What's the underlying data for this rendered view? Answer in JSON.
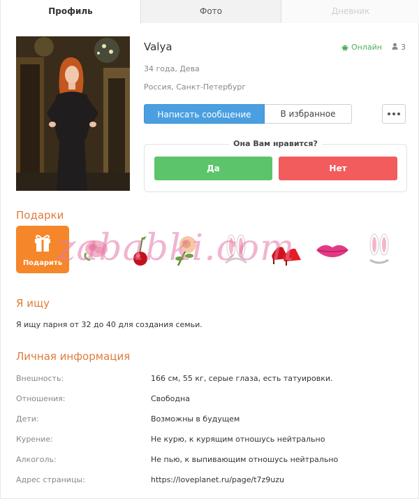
{
  "tabs": [
    {
      "label": "Профиль"
    },
    {
      "label": "Фото"
    },
    {
      "label": "Дневник"
    }
  ],
  "profile": {
    "name": "Valya",
    "online_label": "Онлайн",
    "viewers_count": "3",
    "age_sign": "34 года, Дева",
    "location": "Россия, Санкт-Петербург"
  },
  "actions": {
    "message_label": "Написать сообщение",
    "favorite_label": "В избранное"
  },
  "like": {
    "question": "Она Вам нравится?",
    "yes_label": "Да",
    "no_label": "Нет"
  },
  "gifts": {
    "title": "Подарки",
    "give_label": "Подарить",
    "items": [
      "rose-icon",
      "cherry-icon",
      "rose-flower-icon",
      "bunny-ears-icon",
      "red-shoes-icon",
      "lips-icon",
      "bunny-ears-icon"
    ],
    "watermark": "zababki.com"
  },
  "seeking": {
    "title": "Я ищу",
    "text": "Я ищу парня от 32 до 40 для создания семьи."
  },
  "personal_info": {
    "title": "Личная информация",
    "rows": [
      {
        "label": "Внешность:",
        "value": "166 см, 55 кг, серые глаза, есть татуировки."
      },
      {
        "label": "Отношения:",
        "value": "Свободна"
      },
      {
        "label": "Дети:",
        "value": "Возможны в будущем"
      },
      {
        "label": "Курение:",
        "value": "Не курю, к курящим отношусь нейтрально"
      },
      {
        "label": "Алкоголь:",
        "value": "Не пью, к выпивающим отношусь нейтрально"
      },
      {
        "label": "Адрес страницы:",
        "value": "https://loveplanet.ru/page/t7z9uzu"
      }
    ]
  },
  "colors": {
    "accent_orange": "#e07b3c",
    "message_blue": "#4a9fe0",
    "yes_green": "#5cc46a",
    "no_red": "#f25c5c",
    "online_green": "#4caf50"
  }
}
